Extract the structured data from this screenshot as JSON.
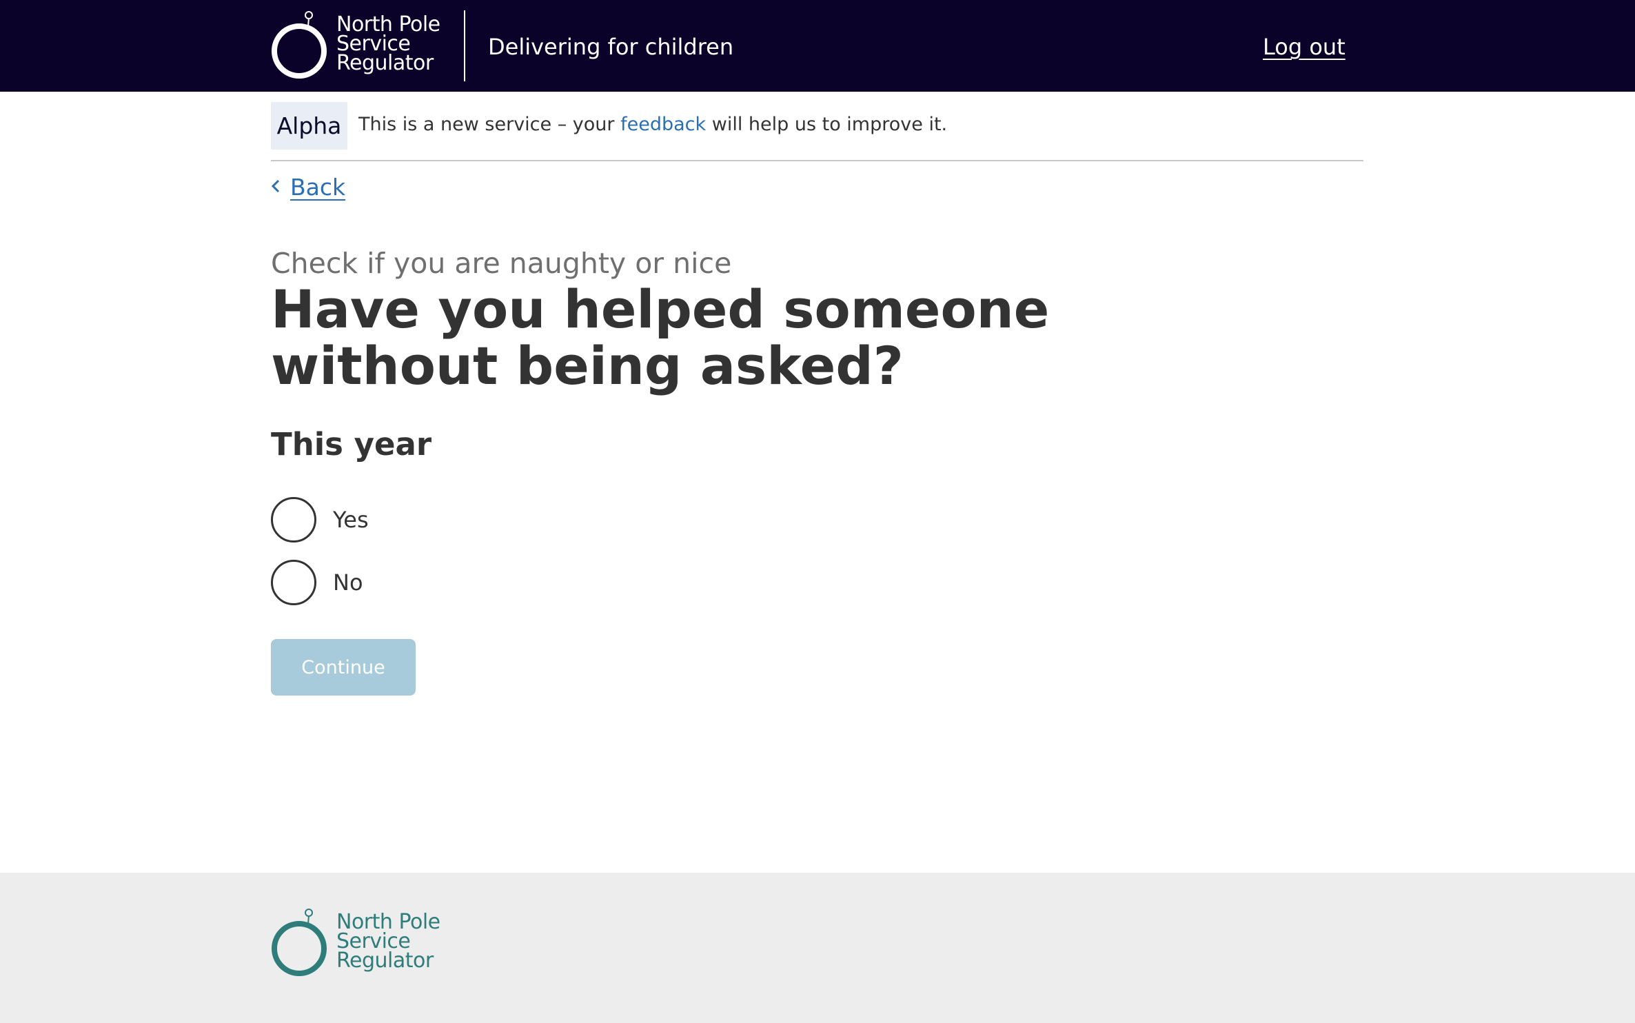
{
  "header": {
    "logo_lines": [
      "North Pole",
      "Service",
      "Regulator"
    ],
    "service_name": "Delivering for children",
    "logout_label": "Log out",
    "background_color": "#0a0228"
  },
  "phase_banner": {
    "tag": "Alpha",
    "text_before": "This is a new service – your",
    "link_text": "feedback",
    "text_after": "will help us to improve it."
  },
  "back_link": {
    "label": "Back",
    "icon": "chevron-left-icon"
  },
  "main": {
    "caption": "Check if you are naughty or nice",
    "question": "Have you helped someone without being asked?",
    "legend": "This year",
    "options": [
      {
        "label": "Yes",
        "selected": false
      },
      {
        "label": "No",
        "selected": false
      }
    ],
    "continue_label": "Continue"
  },
  "footer": {
    "logo_lines": [
      "North Pole",
      "Service",
      "Regulator"
    ],
    "brand_color": "#2e7d7b"
  },
  "colors": {
    "link": "#2a6fb5",
    "button_disabled": "#a7cbda",
    "text": "#333333",
    "footer_bg": "#ededed"
  }
}
